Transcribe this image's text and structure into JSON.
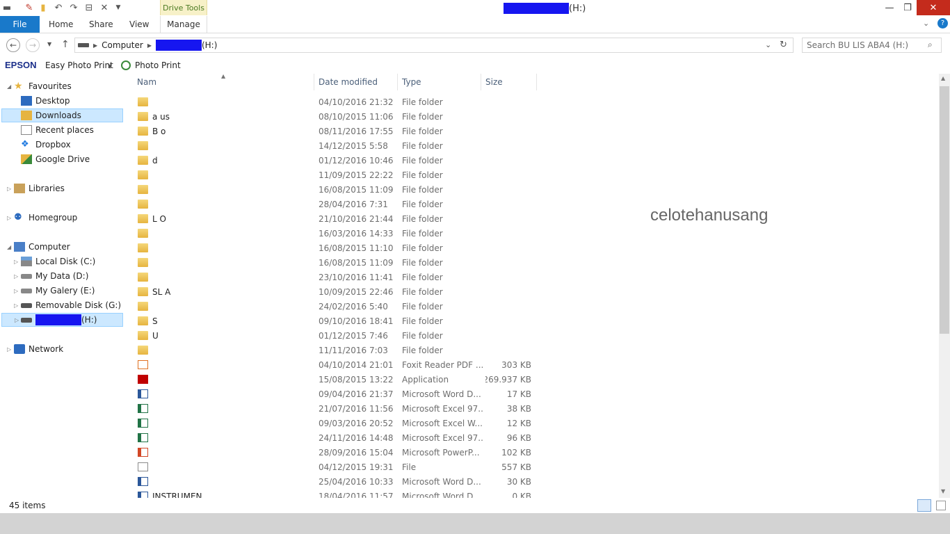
{
  "titlebar": {
    "contextual_tab": "Drive Tools",
    "title_suffix": "(H:)",
    "minimize": "—",
    "restore": "❐",
    "close": "✕"
  },
  "ribbon": {
    "file": "File",
    "tabs": [
      "Home",
      "Share",
      "View",
      "Manage"
    ]
  },
  "address": {
    "segments": [
      "Computer",
      "(H:)"
    ],
    "search_placeholder": "Search BU LIS ABA4 (H:)"
  },
  "toolbar2": {
    "epson": "EPSON",
    "easy_photo": "Easy Photo Print",
    "photo_print": "Photo Print"
  },
  "navpane": {
    "favourites": "Favourites",
    "fav_items": [
      "Desktop",
      "Downloads",
      "Recent places",
      "Dropbox",
      "Google Drive"
    ],
    "libraries": "Libraries",
    "homegroup": "Homegroup",
    "computer": "Computer",
    "drives": [
      "Local Disk (C:)",
      "My Data (D:)",
      "My Galery (E:)",
      "Removable Disk (G:)",
      "(H:)"
    ],
    "network": "Network"
  },
  "columns": {
    "name": "Nam",
    "date": "Date modified",
    "type": "Type",
    "size": "Size"
  },
  "files": [
    {
      "name": "",
      "date": "04/10/2016 21:32",
      "type": "File folder",
      "size": "",
      "icon": "folder"
    },
    {
      "name": "a   us",
      "date": "08/10/2015 11:06",
      "type": "File folder",
      "size": "",
      "icon": "folder"
    },
    {
      "name": "B   o",
      "date": "08/11/2016 17:55",
      "type": "File folder",
      "size": "",
      "icon": "folder"
    },
    {
      "name": "",
      "date": "14/12/2015 5:58",
      "type": "File folder",
      "size": "",
      "icon": "folder"
    },
    {
      "name": "d",
      "date": "01/12/2016 10:46",
      "type": "File folder",
      "size": "",
      "icon": "folder"
    },
    {
      "name": "",
      "date": "11/09/2015 22:22",
      "type": "File folder",
      "size": "",
      "icon": "folder"
    },
    {
      "name": "",
      "date": "16/08/2015 11:09",
      "type": "File folder",
      "size": "",
      "icon": "folder"
    },
    {
      "name": "",
      "date": "28/04/2016 7:31",
      "type": "File folder",
      "size": "",
      "icon": "folder"
    },
    {
      "name": "L   O",
      "date": "21/10/2016 21:44",
      "type": "File folder",
      "size": "",
      "icon": "folder"
    },
    {
      "name": "",
      "date": "16/03/2016 14:33",
      "type": "File folder",
      "size": "",
      "icon": "folder"
    },
    {
      "name": "",
      "date": "16/08/2015 11:10",
      "type": "File folder",
      "size": "",
      "icon": "folder"
    },
    {
      "name": "",
      "date": "16/08/2015 11:09",
      "type": "File folder",
      "size": "",
      "icon": "folder"
    },
    {
      "name": "",
      "date": "23/10/2016 11:41",
      "type": "File folder",
      "size": "",
      "icon": "folder"
    },
    {
      "name": "SL   A",
      "date": "10/09/2015 22:46",
      "type": "File folder",
      "size": "",
      "icon": "folder"
    },
    {
      "name": "",
      "date": "24/02/2016 5:40",
      "type": "File folder",
      "size": "",
      "icon": "folder"
    },
    {
      "name": "S",
      "date": "09/10/2016 18:41",
      "type": "File folder",
      "size": "",
      "icon": "folder"
    },
    {
      "name": "U",
      "date": "01/12/2015 7:46",
      "type": "File folder",
      "size": "",
      "icon": "folder"
    },
    {
      "name": "",
      "date": "11/11/2016 7:03",
      "type": "File folder",
      "size": "",
      "icon": "folder"
    },
    {
      "name": "",
      "date": "04/10/2014 21:01",
      "type": "Foxit Reader PDF ...",
      "size": "303 KB",
      "icon": "pdf"
    },
    {
      "name": "",
      "date": "15/08/2015 13:22",
      "type": "Application",
      "size": "269.937 KB",
      "icon": "app"
    },
    {
      "name": "",
      "date": "09/04/2016 21:37",
      "type": "Microsoft Word D...",
      "size": "17 KB",
      "icon": "word"
    },
    {
      "name": "",
      "date": "21/07/2016 11:56",
      "type": "Microsoft Excel 97...",
      "size": "38 KB",
      "icon": "excel"
    },
    {
      "name": "",
      "date": "09/03/2016 20:52",
      "type": "Microsoft Excel W...",
      "size": "12 KB",
      "icon": "excel"
    },
    {
      "name": "",
      "date": "24/11/2016 14:48",
      "type": "Microsoft Excel 97...",
      "size": "96 KB",
      "icon": "excel"
    },
    {
      "name": "",
      "date": "28/09/2016 15:04",
      "type": "Microsoft PowerP...",
      "size": "102 KB",
      "icon": "ppt"
    },
    {
      "name": "",
      "date": "04/12/2015 19:31",
      "type": "File",
      "size": "557 KB",
      "icon": "doc"
    },
    {
      "name": "",
      "date": "25/04/2016 10:33",
      "type": "Microsoft Word D...",
      "size": "30 KB",
      "icon": "word"
    },
    {
      "name": "INSTRUMEN",
      "date": "18/04/2016 11:57",
      "type": "Microsoft Word D...",
      "size": "0 KB",
      "icon": "word"
    }
  ],
  "watermark": "celotehanusang",
  "status": {
    "items": "45 items"
  }
}
